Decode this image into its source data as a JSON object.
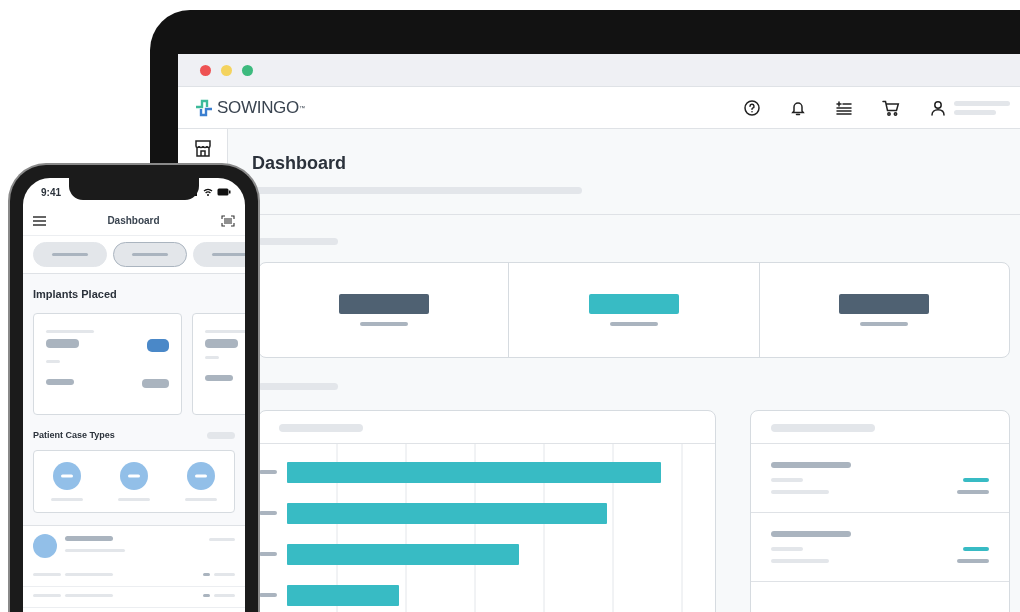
{
  "laptop": {
    "window_dots": [
      {
        "color": "#ee5253"
      },
      {
        "color": "#f4d35e"
      },
      {
        "color": "#3dba7e"
      }
    ],
    "logo": "SOWINGO$^{™}$",
    "page_title": "Dashboard",
    "stat_cards": [
      {
        "color": "#4f6172"
      },
      {
        "color": "#38bbc4"
      },
      {
        "color": "#4f6172"
      }
    ]
  },
  "phone": {
    "time": "9:41",
    "title": "Dashboard",
    "filters": [
      {
        "selected": false
      },
      {
        "selected": true
      },
      {
        "selected": false
      }
    ],
    "section_1": "Implants Placed",
    "section_2": "Patient Case Types"
  }
}
